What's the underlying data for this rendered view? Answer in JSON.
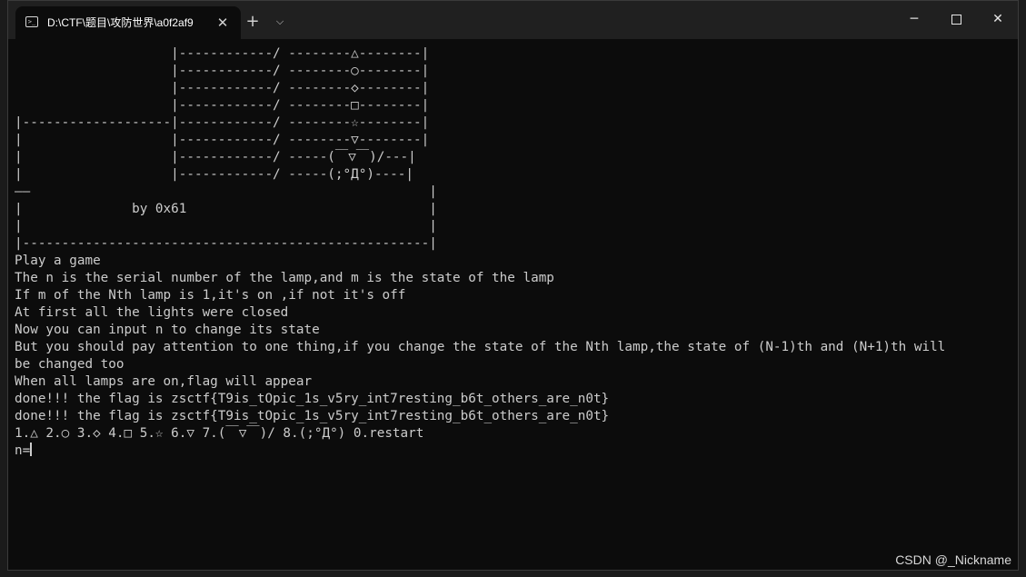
{
  "window": {
    "tab_icon": "terminal-icon",
    "tab_title": "D:\\CTF\\题目\\攻防世界\\a0f2af9",
    "tab_close": "✕",
    "new_tab": "+",
    "tab_dropdown": "⌵",
    "minimize": "─",
    "close": "✕"
  },
  "terminal": {
    "lines": [
      "                    |------------/ --------△--------|",
      "                    |------------/ --------○--------|",
      "                    |------------/ --------◇--------|",
      "                    |------------/ --------□--------|",
      "|-------------------|------------/ --------☆--------|",
      "|                   |------------/ --------▽--------|",
      "|                   |------------/ -----(￣▽￣)/---|",
      "|                   |------------/ -----(;°Д°)----|",
      "——                                                   |",
      "|              by 0x61                               |",
      "|                                                    |",
      "|----------------------------------------------------|",
      "Play a game",
      "The n is the serial number of the lamp,and m is the state of the lamp",
      "If m of the Nth lamp is 1,it's on ,if not it's off",
      "At first all the lights were closed",
      "Now you can input n to change its state",
      "But you should pay attention to one thing,if you change the state of the Nth lamp,the state of (N-1)th and (N+1)th will",
      "be changed too",
      "When all lamps are on,flag will appear",
      "done!!! the flag is zsctf{T9is_tOpic_1s_v5ry_int7resting_b6t_others_are_n0t}",
      "done!!! the flag is zsctf{T9is_tOpic_1s_v5ry_int7resting_b6t_others_are_n0t}",
      "1.△ 2.○ 3.◇ 4.□ 5.☆ 6.▽ 7.(￣▽￣)/ 8.(;°Д°) 0.restart"
    ],
    "prompt": "n="
  },
  "watermark": "CSDN @_Nickname"
}
